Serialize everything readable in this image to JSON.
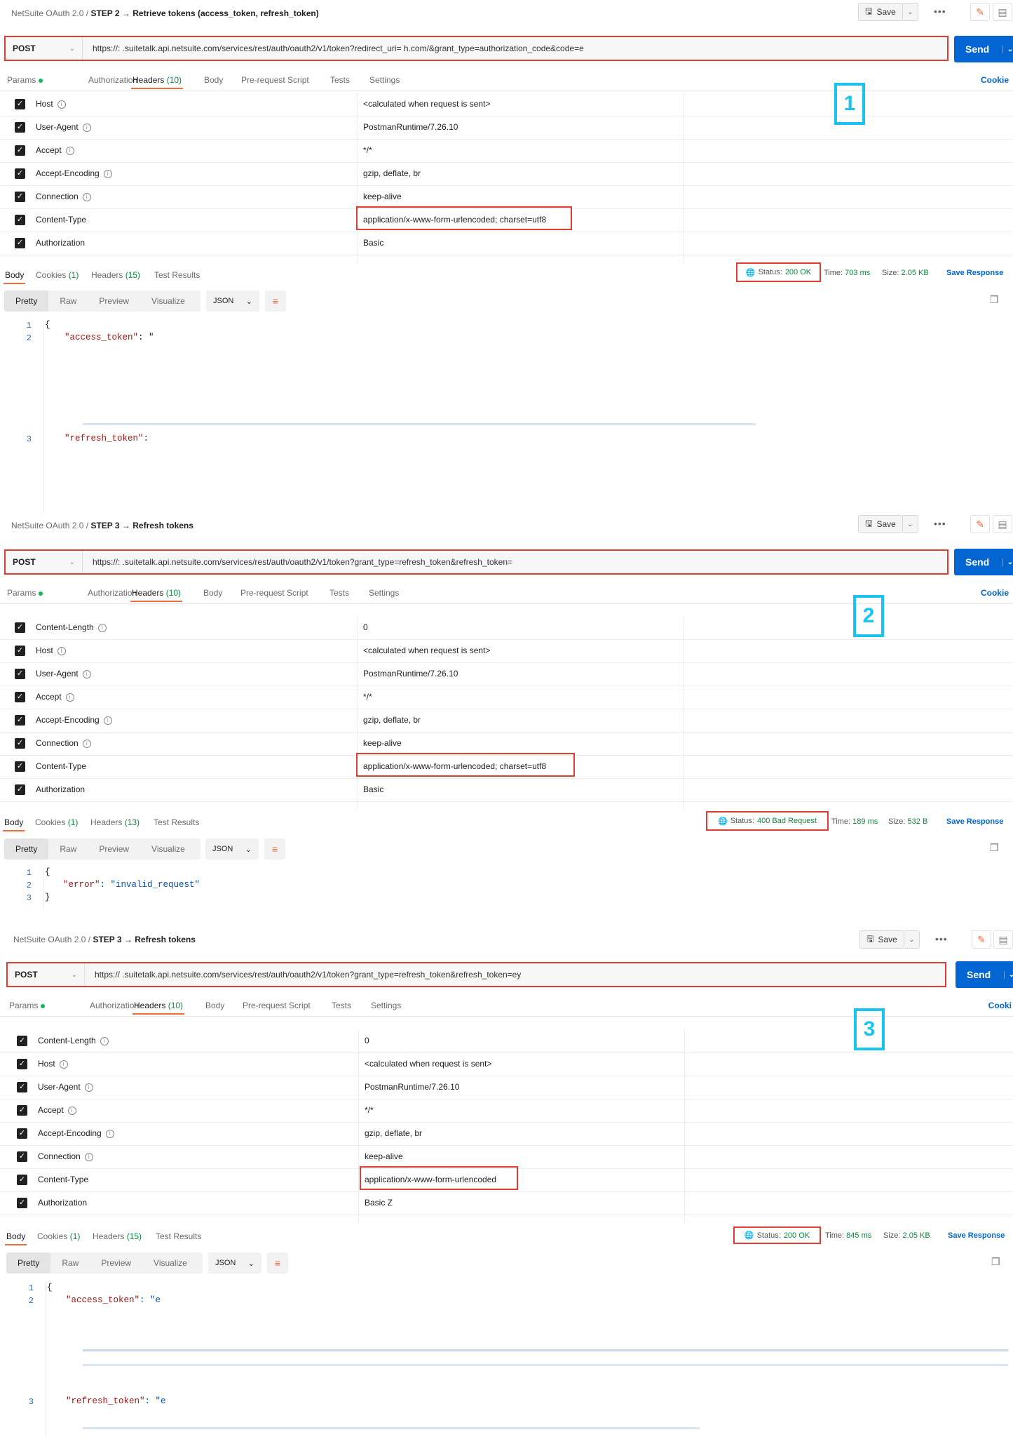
{
  "panels": [
    {
      "breadcrumb": {
        "collection": "NetSuite OAuth 2.0",
        "sep": "/",
        "title": "STEP 2 → Retrieve tokens (access_token, refresh_token)"
      },
      "save_label": "Save",
      "method": "POST",
      "url": "https://:        .suitetalk.api.netsuite.com/services/rest/auth/oauth2/v1/token?redirect_uri=                                h.com/&grant_type=authorization_code&code=e",
      "send_label": "Send",
      "tabs": {
        "params": "Params",
        "authorization": "Authorization",
        "headers": "Headers",
        "headers_count": "(10)",
        "body": "Body",
        "prescript": "Pre-request Script",
        "tests": "Tests",
        "settings": "Settings",
        "cookies": "Cookie"
      },
      "headers": [
        {
          "key": "Host",
          "value": "<calculated when request is sent>"
        },
        {
          "key": "User-Agent",
          "value": "PostmanRuntime/7.26.10"
        },
        {
          "key": "Accept",
          "value": "*/*"
        },
        {
          "key": "Accept-Encoding",
          "value": "gzip, deflate, br"
        },
        {
          "key": "Connection",
          "value": "keep-alive"
        },
        {
          "key": "Content-Type",
          "value": "application/x-www-form-urlencoded; charset=utf8"
        },
        {
          "key": "Authorization",
          "value": "Basic"
        }
      ],
      "annotation": "1",
      "response": {
        "tabs": {
          "body": "Body",
          "cookies": "Cookies",
          "cookies_count": "(1)",
          "headers": "Headers",
          "headers_count": "(15)",
          "tests": "Test Results"
        },
        "status_label": "Status:",
        "status_value": "200 OK",
        "time_label": "Time:",
        "time_value": "703 ms",
        "size_label": "Size:",
        "size_value": "2.05 KB",
        "save_response": "Save Response",
        "views": [
          "Pretty",
          "Raw",
          "Preview",
          "Visualize"
        ],
        "format": "JSON",
        "lines": [
          {
            "n": "1",
            "text": "{"
          },
          {
            "n": "2",
            "key": "\"access_token\"",
            "value": ": \""
          },
          {
            "n": "3",
            "key": "\"refresh_token\"",
            "value": ":"
          }
        ]
      }
    },
    {
      "breadcrumb": {
        "collection": "NetSuite OAuth 2.0",
        "sep": "/",
        "title": "STEP 3 → Refresh tokens"
      },
      "save_label": "Save",
      "method": "POST",
      "url": "https://:        .suitetalk.api.netsuite.com/services/rest/auth/oauth2/v1/token?grant_type=refresh_token&refresh_token=",
      "send_label": "Send",
      "tabs": {
        "params": "Params",
        "authorization": "Authorization",
        "headers": "Headers",
        "headers_count": "(10)",
        "body": "Body",
        "prescript": "Pre-request Script",
        "tests": "Tests",
        "settings": "Settings",
        "cookies": "Cookie"
      },
      "headers": [
        {
          "key": "Content-Length",
          "value": "0"
        },
        {
          "key": "Host",
          "value": "<calculated when request is sent>"
        },
        {
          "key": "User-Agent",
          "value": "PostmanRuntime/7.26.10"
        },
        {
          "key": "Accept",
          "value": "*/*"
        },
        {
          "key": "Accept-Encoding",
          "value": "gzip, deflate, br"
        },
        {
          "key": "Connection",
          "value": "keep-alive"
        },
        {
          "key": "Content-Type",
          "value": "application/x-www-form-urlencoded; charset=utf8"
        },
        {
          "key": "Authorization",
          "value": "Basic"
        }
      ],
      "annotation": "2",
      "response": {
        "tabs": {
          "body": "Body",
          "cookies": "Cookies",
          "cookies_count": "(1)",
          "headers": "Headers",
          "headers_count": "(13)",
          "tests": "Test Results"
        },
        "status_label": "Status:",
        "status_value": "400 Bad Request",
        "time_label": "Time:",
        "time_value": "189 ms",
        "size_label": "Size:",
        "size_value": "532 B",
        "save_response": "Save Response",
        "views": [
          "Pretty",
          "Raw",
          "Preview",
          "Visualize"
        ],
        "format": "JSON",
        "lines": [
          {
            "n": "1",
            "text": "{"
          },
          {
            "n": "2",
            "key": "\"error\"",
            "value": ": \"invalid_request\""
          },
          {
            "n": "3",
            "text": "}"
          }
        ]
      }
    },
    {
      "breadcrumb": {
        "collection": "NetSuite OAuth 2.0",
        "sep": "/",
        "title": "STEP 3 → Refresh tokens"
      },
      "save_label": "Save",
      "method": "POST",
      "url": "https://          .suitetalk.api.netsuite.com/services/rest/auth/oauth2/v1/token?grant_type=refresh_token&refresh_token=ey",
      "send_label": "Send",
      "tabs": {
        "params": "Params",
        "authorization": "Authorization",
        "headers": "Headers",
        "headers_count": "(10)",
        "body": "Body",
        "prescript": "Pre-request Script",
        "tests": "Tests",
        "settings": "Settings",
        "cookies": "Cooki"
      },
      "headers": [
        {
          "key": "Content-Length",
          "value": "0"
        },
        {
          "key": "Host",
          "value": "<calculated when request is sent>"
        },
        {
          "key": "User-Agent",
          "value": "PostmanRuntime/7.26.10"
        },
        {
          "key": "Accept",
          "value": "*/*"
        },
        {
          "key": "Accept-Encoding",
          "value": "gzip, deflate, br"
        },
        {
          "key": "Connection",
          "value": "keep-alive"
        },
        {
          "key": "Content-Type",
          "value": "application/x-www-form-urlencoded"
        },
        {
          "key": "Authorization",
          "value": "Basic Z"
        }
      ],
      "annotation": "3",
      "response": {
        "tabs": {
          "body": "Body",
          "cookies": "Cookies",
          "cookies_count": "(1)",
          "headers": "Headers",
          "headers_count": "(15)",
          "tests": "Test Results"
        },
        "status_label": "Status:",
        "status_value": "200 OK",
        "time_label": "Time:",
        "time_value": "845 ms",
        "size_label": "Size:",
        "size_value": "2.05 KB",
        "save_response": "Save Response",
        "views": [
          "Pretty",
          "Raw",
          "Preview",
          "Visualize"
        ],
        "format": "JSON",
        "lines": [
          {
            "n": "1",
            "text": "{"
          },
          {
            "n": "2",
            "key": "\"access_token\"",
            "value": ": \"e"
          },
          {
            "n": "3",
            "key": "\"refresh_token\"",
            "value": ": \"e"
          }
        ]
      }
    }
  ]
}
